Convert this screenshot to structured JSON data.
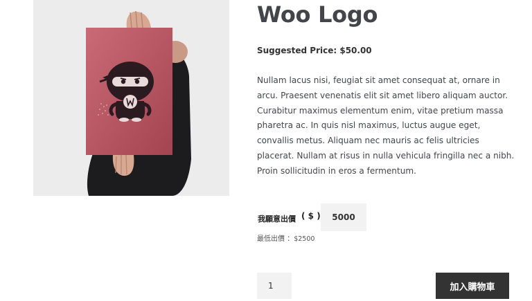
{
  "product": {
    "title": "Woo Logo",
    "suggested_price": "Suggested Price: $50.00",
    "description": "Nullam lacus nisi, feugiat sit amet consequat at, ornare in arcu. Praesent venenatis elit sit amet libero aliquam auctor. Curabitur maximus elementum enim, vitae pretium massa pharetra ac. In quis nisl maximus, luctus augue eget, convallis metus. Aliquam nec mauris ac felis ultricies placerat. Nullam at risus in nulla vehicula fringilla nec a nibh. Proin sollicitudin in eros a fermentum.",
    "image": {
      "poster_letter": "W",
      "poster_color": "#c0505f",
      "background": "#ececec"
    }
  },
  "name_your_price": {
    "label": "我願意出價",
    "currency": "( $ )",
    "value": "5000",
    "min_label": "最低出價 ：",
    "min_amount": "$2500"
  },
  "cart": {
    "quantity": "1",
    "add_button_label": "加入購物車"
  },
  "colors": {
    "button_bg": "#333333",
    "input_bg": "#f2f2f2",
    "text": "#43454b"
  }
}
